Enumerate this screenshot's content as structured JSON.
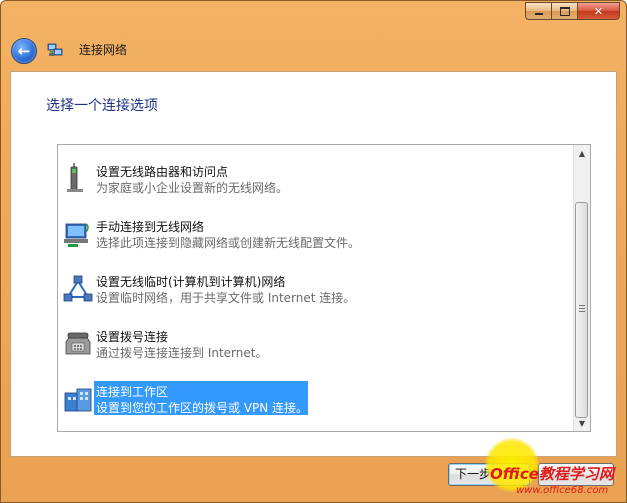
{
  "window": {
    "title": "连接网络"
  },
  "heading": "选择一个连接选项",
  "options": [
    {
      "title": "设置无线路由器和访问点",
      "desc": "为家庭或小企业设置新的无线网络。",
      "icon": "router-icon"
    },
    {
      "title": "手动连接到无线网络",
      "desc": "选择此项连接到隐藏网络或创建新无线配置文件。",
      "icon": "wireless-network-icon"
    },
    {
      "title": "设置无线临时(计算机到计算机)网络",
      "desc": "设置临时网络，用于共享文件或 Internet 连接。",
      "icon": "adhoc-network-icon"
    },
    {
      "title": "设置拨号连接",
      "desc": "通过拨号连接连接到 Internet。",
      "icon": "dialup-phone-icon"
    },
    {
      "title": "连接到工作区",
      "desc": "设置到您的工作区的拨号或 VPN 连接。",
      "icon": "workplace-icon",
      "selected": true
    }
  ],
  "buttons": {
    "next": "下一步"
  },
  "watermark": {
    "logo": "Office教程学习网",
    "url": "www.office68.com"
  },
  "colors": {
    "frame": "#eea85a",
    "selection": "#3399ff",
    "heading": "#1e3287"
  }
}
